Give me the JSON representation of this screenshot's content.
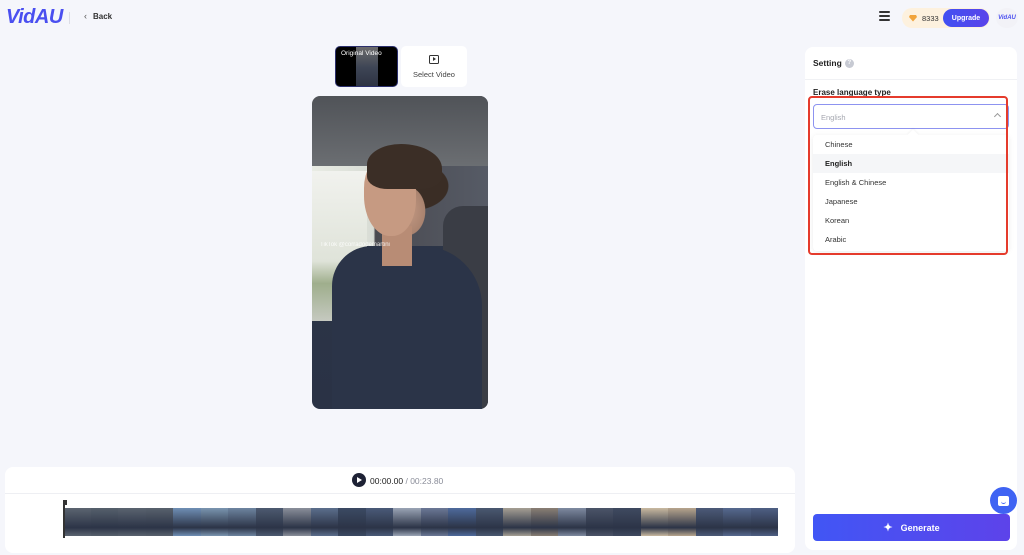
{
  "header": {
    "logo": "VidAU",
    "back_label": "Back",
    "credits": "8333",
    "upgrade_label": "Upgrade",
    "avatar_text": "VidAU",
    "icons": {
      "back": "chevron-left-icon",
      "tasks": "task-list-icon",
      "credits": "gem-icon"
    }
  },
  "source_tabs": {
    "original_label": "Original Video",
    "select_label": "Select Video"
  },
  "video": {
    "watermark": "TikTok @corradodemartini"
  },
  "timeline": {
    "current_time": "00:00.00",
    "separator": " / ",
    "total_time": "00:23.80",
    "frame_colors": [
      "#5b6470",
      "#56606c",
      "#5a636f",
      "#58616d",
      "#6f8fb5",
      "#7a95b0",
      "#6d84a0",
      "#4d5a70",
      "#8a8f9a",
      "#5b6e8c",
      "#3b4a63",
      "#4a5a78",
      "#9aa4b5",
      "#6b7896",
      "#4e6a9c",
      "#4a5870",
      "#a59f93",
      "#8a7f74",
      "#7e8aa0",
      "#4b5468",
      "#3f4a60",
      "#c9b9a0",
      "#b7a58d",
      "#4c5a78",
      "#56698f",
      "#4e5f84"
    ]
  },
  "settings": {
    "title": "Setting",
    "help_icon": "?",
    "field_label": "Erase language type",
    "selected_value": "English",
    "options": [
      {
        "label": "Chinese",
        "active": false
      },
      {
        "label": "English",
        "active": true
      },
      {
        "label": "English & Chinese",
        "active": false
      },
      {
        "label": "Japanese",
        "active": false
      },
      {
        "label": "Korean",
        "active": false
      },
      {
        "label": "Arabic",
        "active": false
      }
    ],
    "generate_label": "Generate"
  },
  "colors": {
    "brand": "#4a4ff0",
    "accent_gradient_start": "#4156f5",
    "accent_gradient_end": "#5d43ea",
    "highlight_border": "#e53b2c",
    "credits_bg": "#fdf1de"
  }
}
